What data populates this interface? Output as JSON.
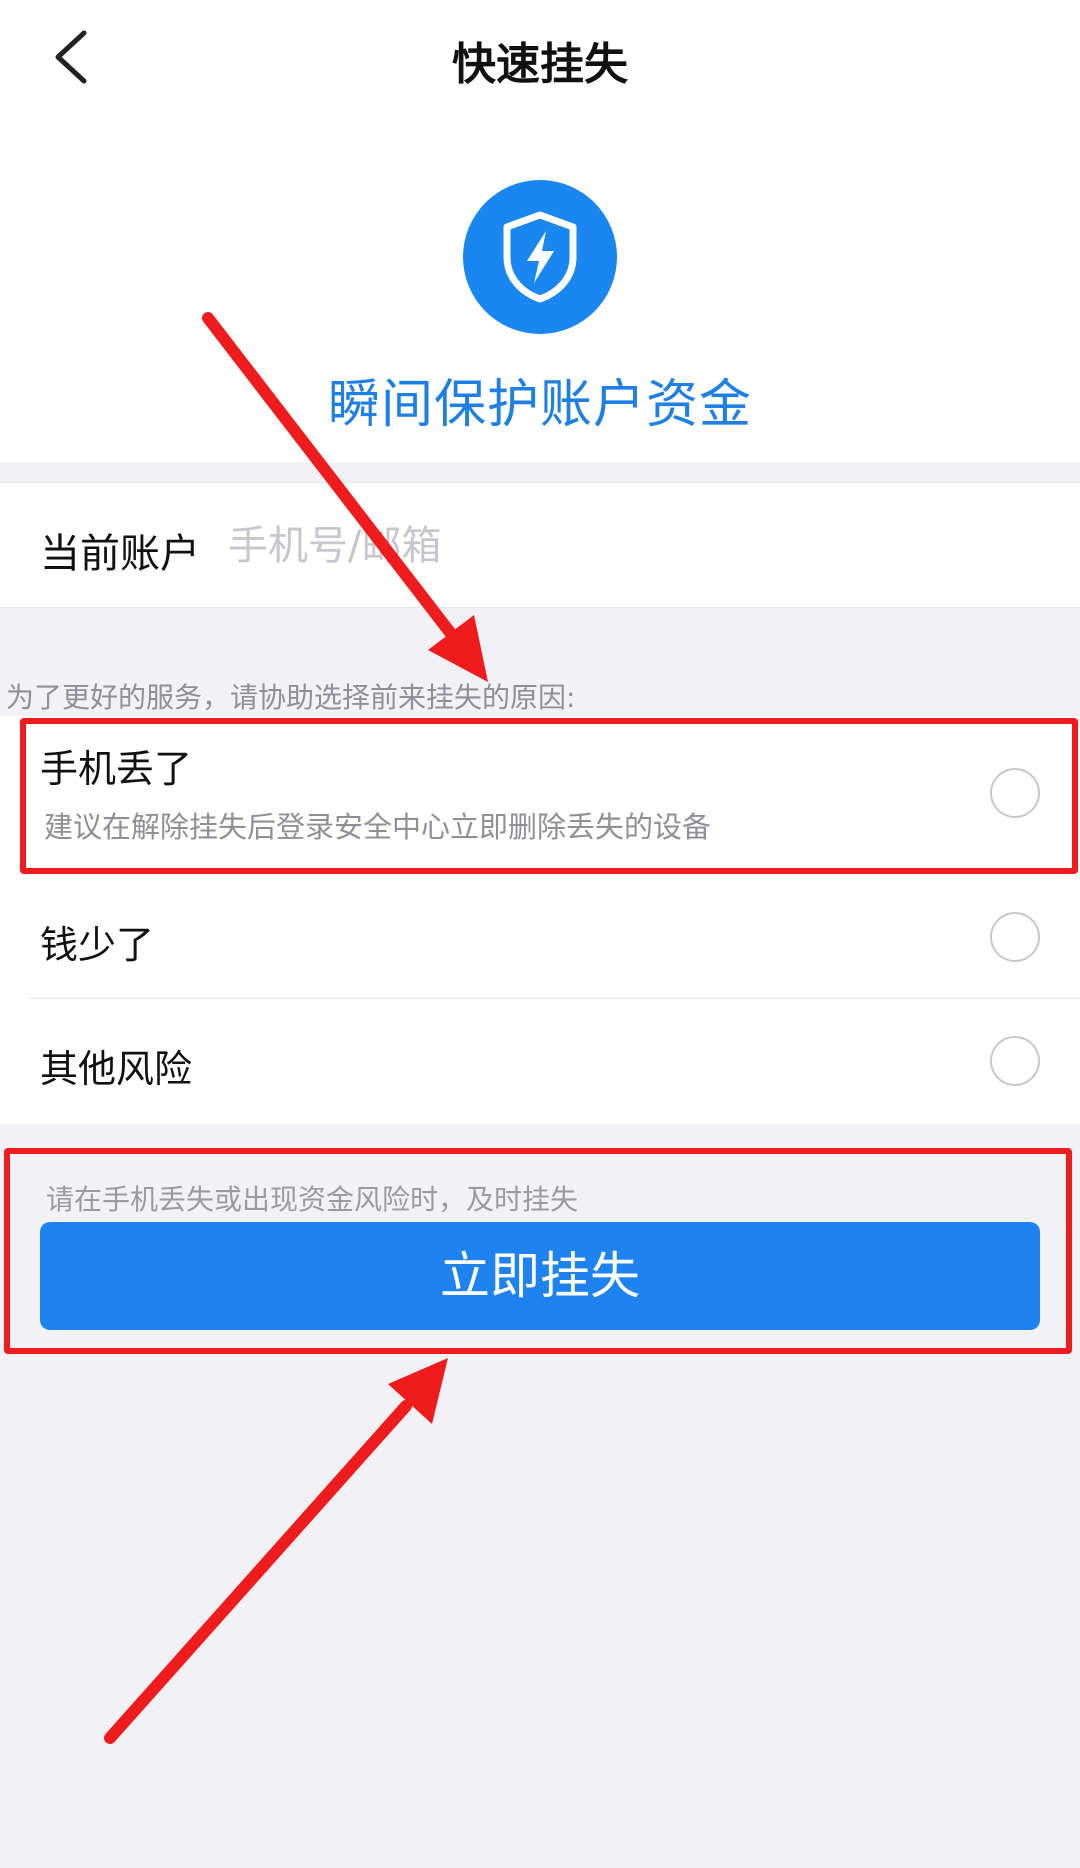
{
  "header": {
    "title": "快速挂失",
    "back_icon": "chevron-left-icon"
  },
  "hero": {
    "icon": "shield-lightning-icon",
    "title": "瞬间保护账户资金"
  },
  "account": {
    "label": "当前账户",
    "placeholder": "手机号/邮箱",
    "value": ""
  },
  "reason_prompt": "为了更好的服务，请协助选择前来挂失的原因:",
  "options": [
    {
      "label": "手机丢了",
      "description": "建议在解除挂失后登录安全中心立即删除丢失的设备",
      "selected": false
    },
    {
      "label": "钱少了",
      "selected": false
    },
    {
      "label": "其他风险",
      "selected": false
    }
  ],
  "footer_hint": "请在手机丢失或出现资金风险时，及时挂失",
  "submit_button": "立即挂失",
  "colors": {
    "accent": "#1f82f1",
    "hero_title": "#1f7fe3",
    "annotation": "#ee1c1c",
    "background": "#f2f1f6"
  }
}
